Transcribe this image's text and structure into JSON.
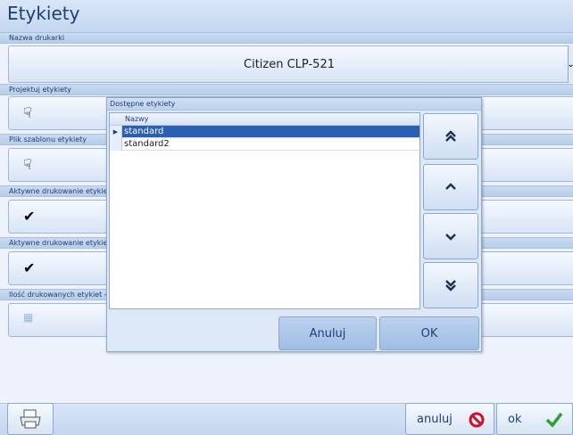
{
  "window": {
    "title": "Etykiety"
  },
  "sections": {
    "printer_name": "Nazwa drukarki",
    "design_label": "Projektuj etykiety",
    "template_file": "Plik szablonu etykiety",
    "active_print_1": "Aktywne drukowanie etykiet",
    "active_print_2": "Aktywne drukowanie etykiet",
    "label_count": "Ilość drukowanych etykiet -"
  },
  "printer": {
    "value": "Citizen CLP-521"
  },
  "dialog": {
    "title": "Dostępne etykiety",
    "column_header": "Nazwy",
    "rows": [
      {
        "name": "standard",
        "selected": true
      },
      {
        "name": "standard2",
        "selected": false
      }
    ],
    "cancel_label": "Anuluj",
    "ok_label": "OK"
  },
  "footer": {
    "cancel_label": "anuluj",
    "ok_label": "ok"
  },
  "icons": {
    "hand": "hand-pointer-icon",
    "check": "checkmark-icon",
    "calculator": "calculator-icon",
    "printer": "printer-icon",
    "cancel": "cancel-circle-icon",
    "ok": "green-check-icon",
    "move_top": "double-chevron-up-icon",
    "move_up": "chevron-up-icon",
    "move_down": "chevron-down-icon",
    "move_bottom": "double-chevron-down-icon"
  },
  "colors": {
    "accent": "#2b5fb2",
    "cancel": "#d0102a",
    "ok": "#2aa32a"
  }
}
